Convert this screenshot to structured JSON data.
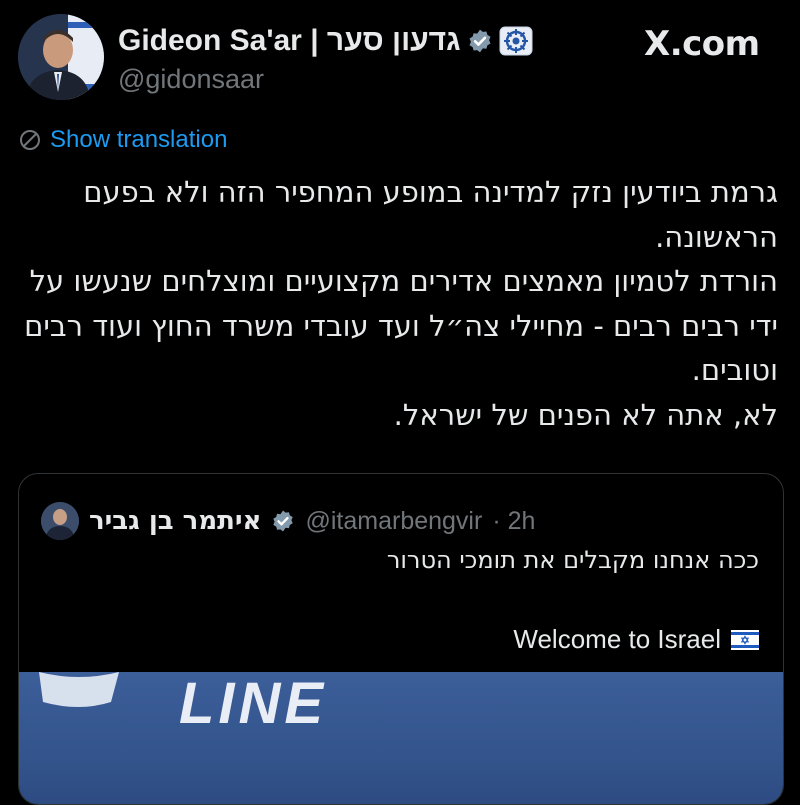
{
  "author": {
    "name": "Gideon Sa'ar | גדעון סער",
    "handle": "@gidonsaar"
  },
  "brand": "X.com",
  "translate_label": "Show translation",
  "tweet": {
    "paragraphs": [
      "גרמת ביודעין נזק למדינה במופע המחפיר הזה ולא בפעם הראשונה.",
      "הורדת לטמיון מאמצים אדירים מקצועיים ומוצלחים שנעשו על ידי רבים רבים - מחיילי צה״ל ועד עובדי משרד החוץ ועוד רבים וטובים.",
      "לא, אתה לא הפנים של ישראל."
    ]
  },
  "quote": {
    "name": "איתמר בן גביר",
    "handle": "@itamarbengvir",
    "time": "· 2h",
    "text_he": "ככה אנחנו מקבלים את תומכי הטרור",
    "text_en": "Welcome to Israel",
    "media_text": "LINE"
  },
  "colors": {
    "accent": "#1d9bf0",
    "background": "#000000",
    "text": "#e7e9ea",
    "muted": "#71767b"
  }
}
